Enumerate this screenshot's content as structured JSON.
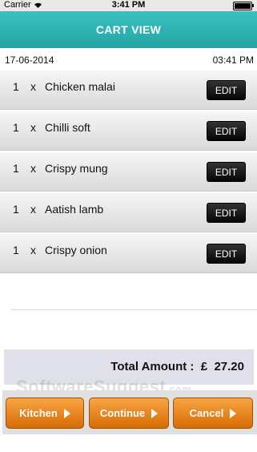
{
  "status_bar": {
    "carrier": "Carrier",
    "time": "3:41 PM"
  },
  "nav": {
    "title": "CART VIEW"
  },
  "order_meta": {
    "date": "17-06-2014",
    "time": "03:41 PM"
  },
  "items": [
    {
      "qty": "1",
      "x": "x",
      "name": "Chicken malai",
      "edit_label": "EDIT"
    },
    {
      "qty": "1",
      "x": "x",
      "name": "Chilli soft",
      "edit_label": "EDIT"
    },
    {
      "qty": "1",
      "x": "x",
      "name": "Crispy mung",
      "edit_label": "EDIT"
    },
    {
      "qty": "1",
      "x": "x",
      "name": "Aatish lamb",
      "edit_label": "EDIT"
    },
    {
      "qty": "1",
      "x": "x",
      "name": "Crispy onion",
      "edit_label": "EDIT"
    }
  ],
  "total": {
    "label": "Total Amount :",
    "currency": "£",
    "amount": "27.20"
  },
  "buttons": {
    "kitchen": "Kitchen",
    "continue": "Continue",
    "cancel": "Cancel"
  },
  "watermark": {
    "text": "SoftwareSuggest",
    "suffix": ".com"
  },
  "colors": {
    "nav": "#23a5a6",
    "button": "#f08a1a"
  }
}
